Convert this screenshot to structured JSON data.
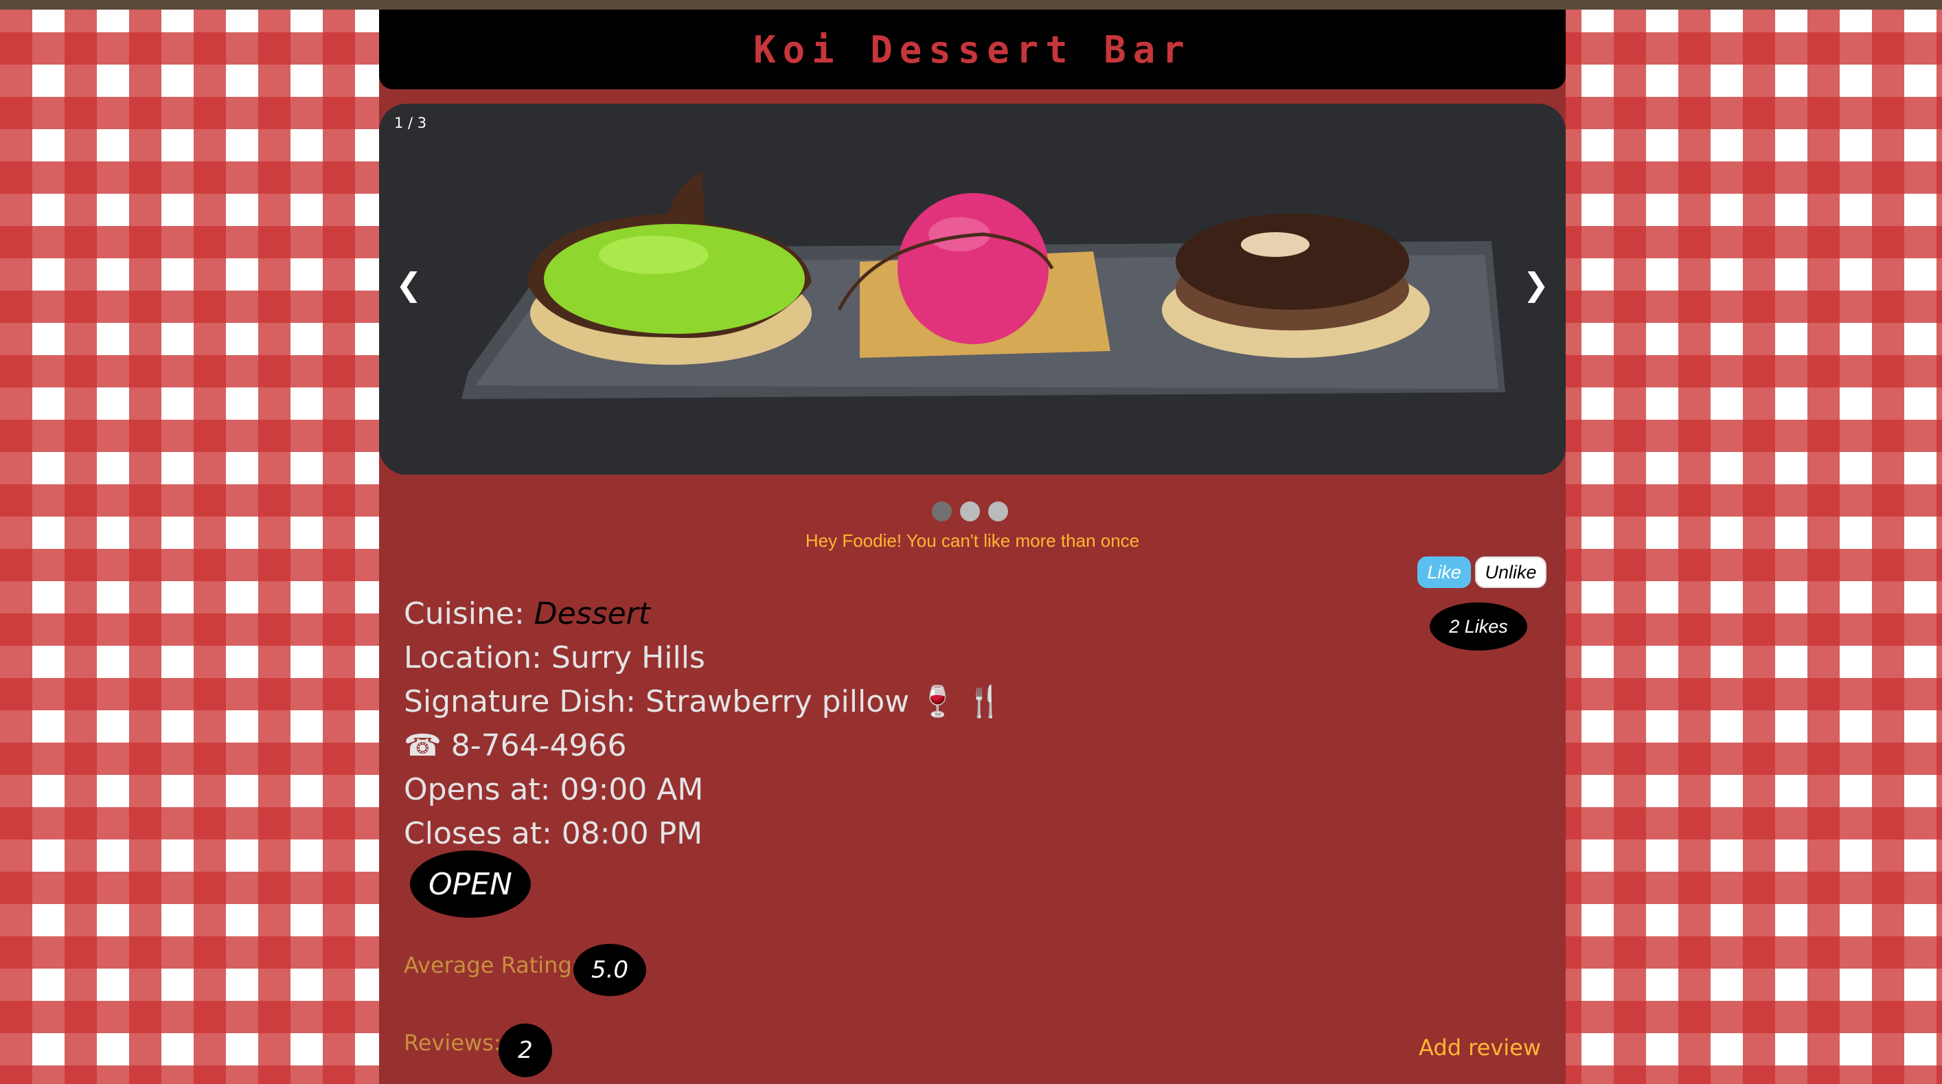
{
  "header": {
    "title": "Koi Dessert Bar"
  },
  "carousel": {
    "counter": "1 / 3",
    "prev": "❮",
    "next": "❯",
    "slide_count": 3,
    "active_slide": 1
  },
  "notice": "Hey Foodie! You can't like more than once",
  "likes": {
    "like_label": "Like",
    "unlike_label": "Unlike",
    "count_text": "2 Likes"
  },
  "info": {
    "cuisine_label": "Cuisine:",
    "cuisine_value": "Dessert",
    "location": "Location: Surry Hills",
    "signature": "Signature Dish: Strawberry pillow 🍷 🍴",
    "phone": "☎ 8-764-4966",
    "opens": "Opens at: 09:00 AM",
    "closes": "Closes at: 08:00 PM"
  },
  "status": "OPEN",
  "rating": {
    "label": "Average Rating:",
    "value": "5.0"
  },
  "reviews": {
    "label": "Reviews:",
    "count": "2",
    "add_label": "Add review"
  },
  "colors": {
    "panel": "#963130",
    "accent": "#ffb830",
    "like_blue": "#5bc0ef"
  }
}
